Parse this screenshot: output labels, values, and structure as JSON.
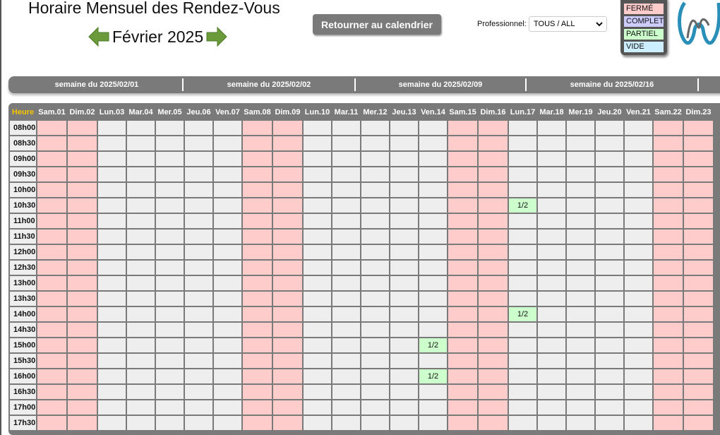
{
  "header": {
    "title": "Horaire Mensuel des Rendez-Vous",
    "month": "Février 2025",
    "back_button": "Retourner au calendrier",
    "professional_label": "Professionnel:",
    "professional_value": "TOUS / ALL"
  },
  "legend": [
    {
      "label": "FERMÉ",
      "color": "#ffcccc"
    },
    {
      "label": "COMPLET",
      "color": "#ccccff"
    },
    {
      "label": "PARTIEL",
      "color": "#ccffcc"
    },
    {
      "label": "VIDE",
      "color": "#cceeff"
    }
  ],
  "weeks": [
    "semaine du 2025/02/01",
    "semaine du 2025/02/02",
    "semaine du 2025/02/09",
    "semaine du 2025/02/16",
    ""
  ],
  "grid": {
    "heure_label": "Heure",
    "days": [
      "Sam.01",
      "Dim.02",
      "Lun.03",
      "Mar.04",
      "Mer.05",
      "Jeu.06",
      "Ven.07",
      "Sam.08",
      "Dim.09",
      "Lun.10",
      "Mar.11",
      "Mer.12",
      "Jeu.13",
      "Ven.14",
      "Sam.15",
      "Dim.16",
      "Lun.17",
      "Mar.18",
      "Mer.19",
      "Jeu.20",
      "Ven.21",
      "Sam.22",
      "Dim.23"
    ],
    "times": [
      "08h00",
      "08h30",
      "09h00",
      "09h30",
      "10h00",
      "10h30",
      "11h00",
      "11h30",
      "12h00",
      "12h30",
      "13h00",
      "13h30",
      "14h00",
      "14h30",
      "15h00",
      "15h30",
      "16h00",
      "16h30",
      "17h00",
      "17h30"
    ],
    "slots": [
      {
        "day": "Lun.17",
        "time": "10h30",
        "text": "1/2",
        "status": "PARTIEL"
      },
      {
        "day": "Lun.17",
        "time": "14h00",
        "text": "1/2",
        "status": "PARTIEL"
      },
      {
        "day": "Ven.14",
        "time": "15h00",
        "text": "1/2",
        "status": "PARTIEL"
      },
      {
        "day": "Ven.14",
        "time": "16h00",
        "text": "1/2",
        "status": "PARTIEL"
      }
    ]
  },
  "colors": {
    "closed": "#ffcccc",
    "partial": "#ccffcc",
    "empty": "#eeeeee",
    "header_bg": "#7a7a7a",
    "heure_text": "#f5c400"
  }
}
